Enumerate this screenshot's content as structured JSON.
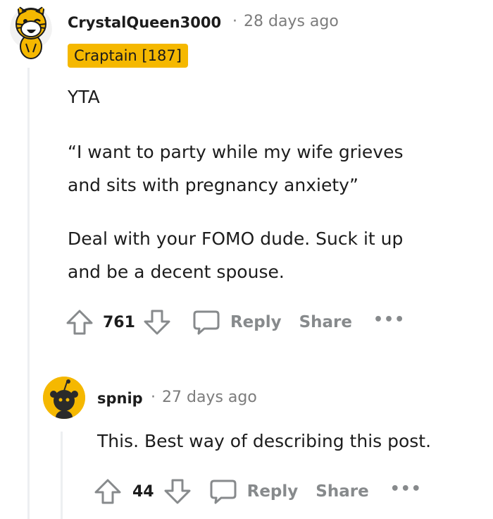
{
  "comment": {
    "username": "CrystalQueen3000",
    "separator": "·",
    "time": "28 days ago",
    "flair": "Craptain [187]",
    "body": {
      "p1": "YTA",
      "p2_line1": "“I want to party while my wife grieves",
      "p2_line2": "and sits with pregnancy anxiety”",
      "p3_line1": "Deal with your FOMO dude. Suck it up",
      "p3_line2": "and be a decent spouse."
    },
    "votes": "761",
    "reply_label": "Reply",
    "share_label": "Share",
    "more_label": "•••"
  },
  "reply": {
    "username": "spnip",
    "separator": "·",
    "time": "27 days ago",
    "body": "This. Best way of describing this post.",
    "votes": "44",
    "reply_label": "Reply",
    "share_label": "Share",
    "more_label": "•••"
  },
  "colors": {
    "flair_bg": "#f5b800",
    "meta_gray": "#7c7c7c",
    "action_gray": "#878a8c",
    "thread_line": "#edeff1"
  },
  "icons": [
    "tiger-avatar-icon",
    "snoo-avatar-icon",
    "upvote-icon",
    "downvote-icon",
    "comment-bubble-icon",
    "more-icon"
  ]
}
